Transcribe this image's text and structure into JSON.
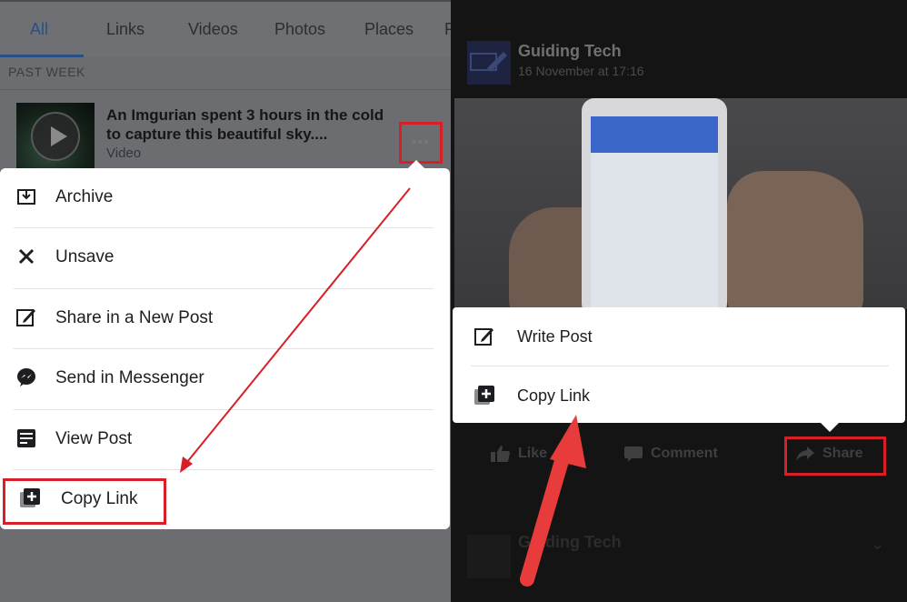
{
  "left": {
    "tabs": [
      {
        "label": "All"
      },
      {
        "label": "Links"
      },
      {
        "label": "Videos"
      },
      {
        "label": "Photos"
      },
      {
        "label": "Places"
      },
      {
        "label": "P"
      }
    ],
    "section_label": "PAST WEEK",
    "saved_item": {
      "title": "An Imgurian spent 3 hours in the cold to capture this beautiful sky....",
      "type": "Video",
      "more": "•••"
    },
    "menu": [
      {
        "label": "Archive",
        "icon": "archive-icon"
      },
      {
        "label": "Unsave",
        "icon": "close-icon"
      },
      {
        "label": "Share in a New Post",
        "icon": "compose-icon"
      },
      {
        "label": "Send in Messenger",
        "icon": "messenger-icon"
      },
      {
        "label": "View Post",
        "icon": "post-icon"
      },
      {
        "label": "Copy Link",
        "icon": "copy-link-icon"
      }
    ]
  },
  "right": {
    "post": {
      "page_name": "Guiding Tech",
      "timestamp": "16 November at 17:16"
    },
    "share_menu": [
      {
        "label": "Write Post",
        "icon": "compose-icon"
      },
      {
        "label": "Copy Link",
        "icon": "copy-link-icon"
      }
    ],
    "actions": {
      "like": "Like",
      "comment": "Comment",
      "share": "Share"
    },
    "next_post": {
      "page_name": "Guiding Tech",
      "chevron": "⌄"
    }
  },
  "colors": {
    "highlight": "#d81f26",
    "arrow": "#e83b3b",
    "fb_blue": "#2a4e8a"
  }
}
